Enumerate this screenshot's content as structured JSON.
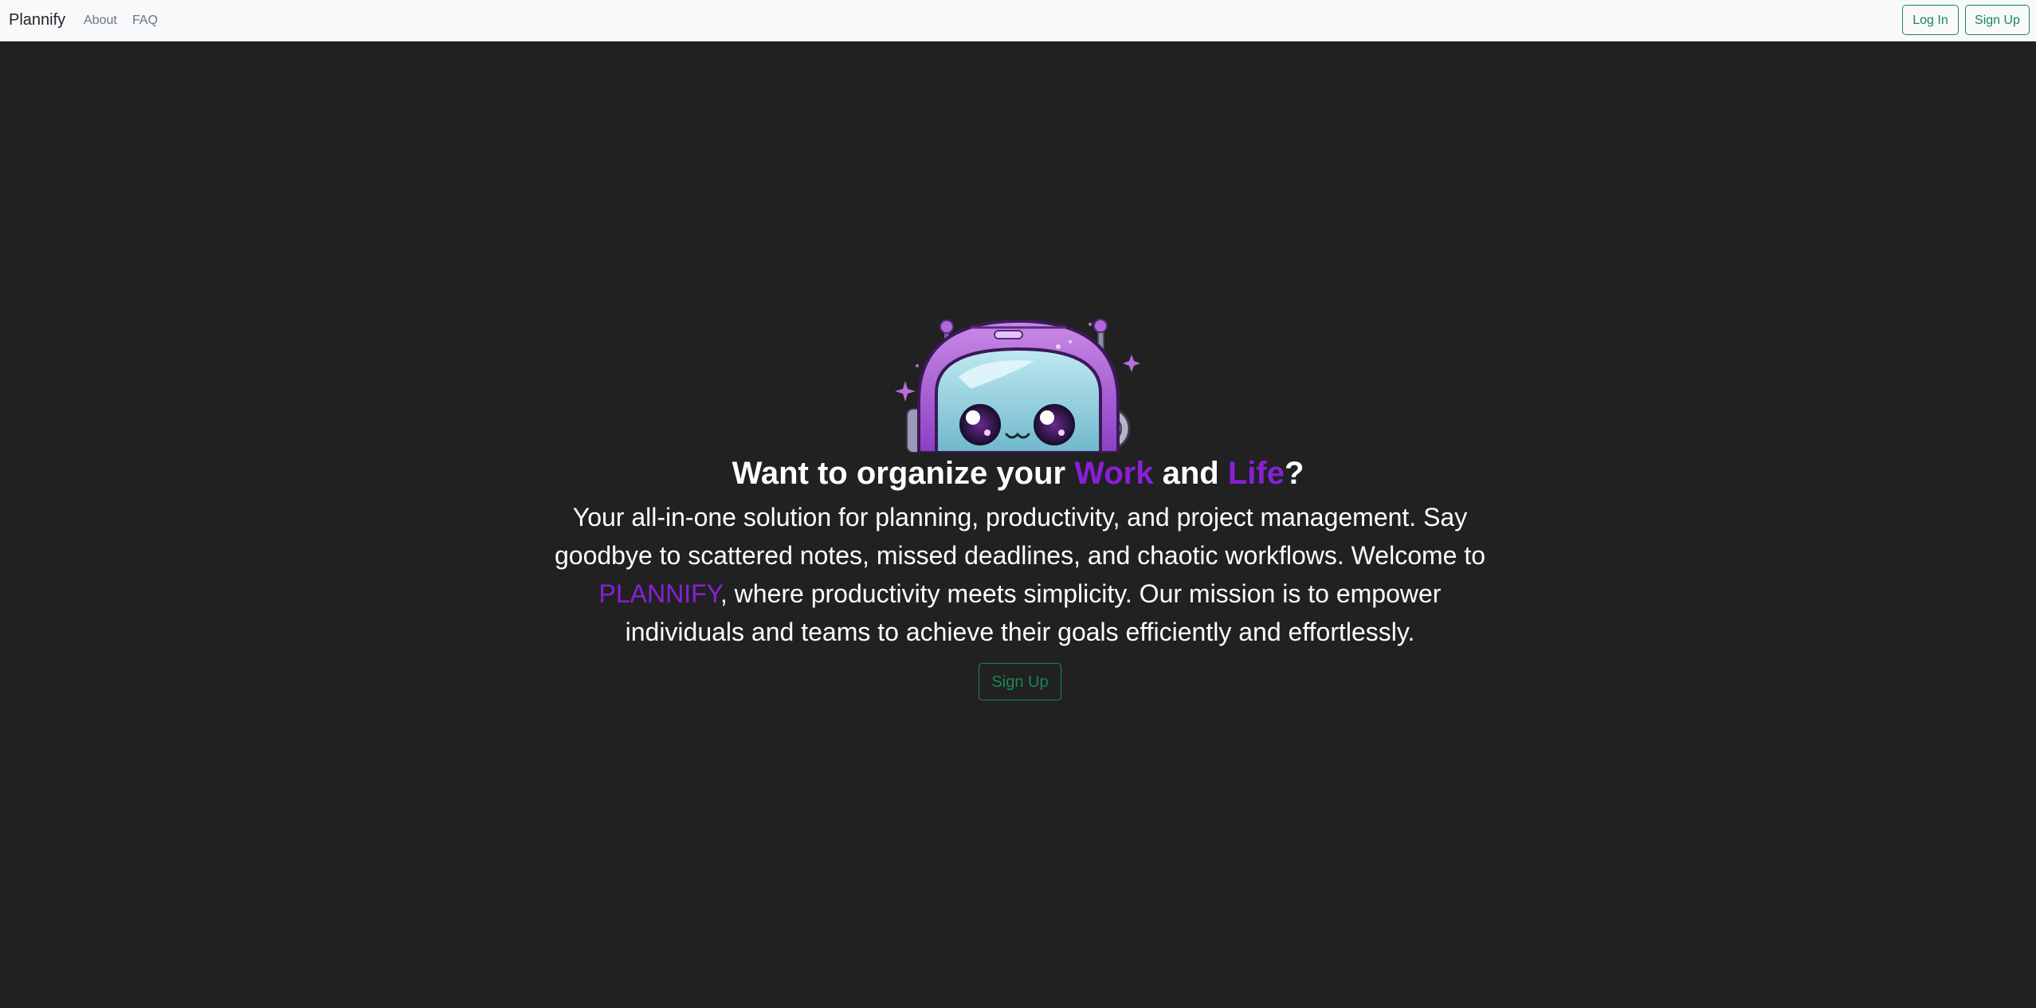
{
  "navbar": {
    "brand": "Plannify",
    "links": [
      {
        "label": "About"
      },
      {
        "label": "FAQ"
      }
    ],
    "login_label": "Log In",
    "signup_label": "Sign Up"
  },
  "hero": {
    "headline_prefix": "Want to organize your ",
    "headline_work": "Work",
    "headline_and": " and ",
    "headline_life": "Life",
    "headline_suffix": "?",
    "description_before": "Your all-in-one solution for planning, productivity, and project management. Say goodbye to scattered notes, missed deadlines, and chaotic workflows. Welcome to ",
    "description_brand": "PLANNIFY",
    "description_after": ", where productivity meets simplicity. Our mission is to empower individuals and teams to achieve their goals efficiently and effortlessly.",
    "signup_label": "Sign Up"
  },
  "colors": {
    "background": "#212121",
    "accent": "#8a1fd6",
    "button_green": "#198754",
    "navbar_bg": "#f8f9fa"
  },
  "icons": {
    "mascot": "robot-mascot-illustration"
  }
}
